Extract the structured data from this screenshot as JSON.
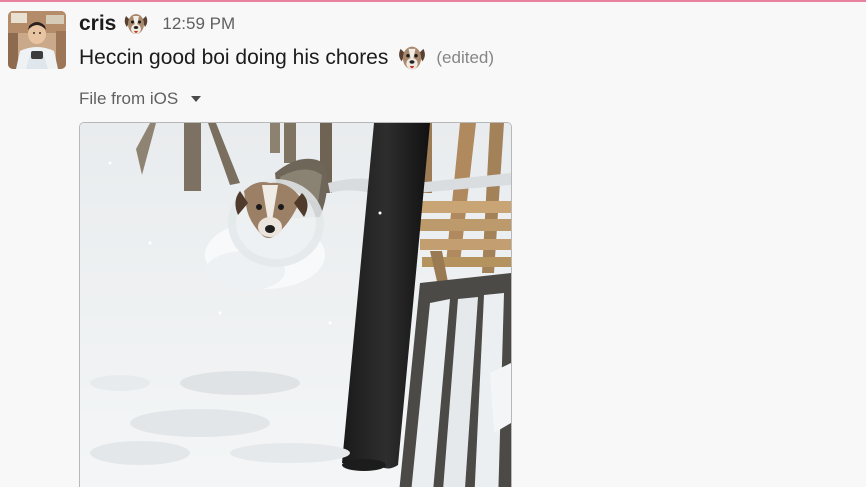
{
  "message": {
    "author": "cris",
    "author_emoji": "dog-face-emoji",
    "timestamp": "12:59 PM",
    "text": "Heccin good boi doing his chores",
    "text_emoji": "dog-face-emoji",
    "edited_label": "(edited)"
  },
  "attachment": {
    "label": "File from iOS",
    "image_subject": "dog-in-snow-photo"
  },
  "colors": {
    "accent_bar": "#e8819d",
    "background": "#f8f8f8",
    "text_primary": "#1d1c1d",
    "text_secondary": "#616061"
  }
}
